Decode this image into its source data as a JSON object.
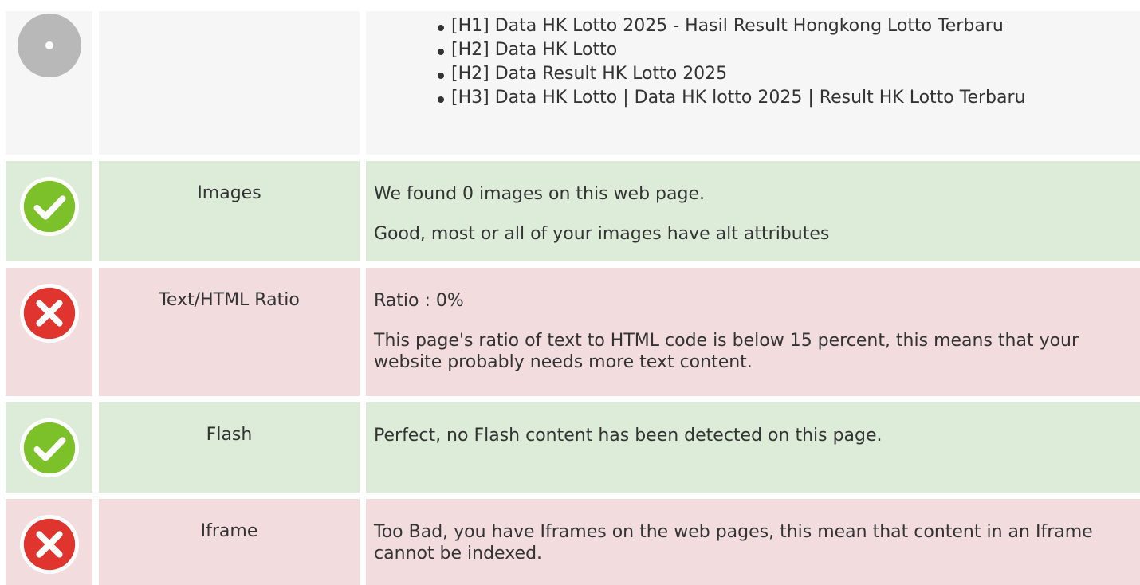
{
  "headings_row": {
    "icon": "neutral-circle-icon",
    "items": [
      "[H1] Data HK Lotto 2025 - Hasil Result Hongkong Lotto Terbaru",
      "[H2] Data HK Lotto",
      "[H2] Data Result HK Lotto 2025",
      "[H3] Data HK Lotto | Data HK lotto 2025 | Result HK Lotto Terbaru"
    ]
  },
  "rows": [
    {
      "status": "pass",
      "icon": "check-icon",
      "label": "Images",
      "paragraphs": [
        "We found 0 images on this web page.",
        "Good, most or all of your images have alt attributes"
      ]
    },
    {
      "status": "fail",
      "icon": "cross-icon",
      "label": "Text/HTML Ratio",
      "paragraphs": [
        "Ratio : 0%",
        "This page's ratio of text to HTML code is below 15 percent, this means that your website probably needs more text content."
      ]
    },
    {
      "status": "pass",
      "icon": "check-icon",
      "label": "Flash",
      "paragraphs": [
        "Perfect, no Flash content has been detected on this page."
      ]
    },
    {
      "status": "fail",
      "icon": "cross-icon",
      "label": "Iframe",
      "paragraphs": [
        "Too Bad, you have Iframes on the web pages, this mean that content in an Iframe cannot be indexed."
      ]
    }
  ],
  "colors": {
    "pass_bg": "#dcecd9",
    "fail_bg": "#f2dcdd",
    "neutral_bg": "#f6f6f6",
    "check": "#7cc02a",
    "cross": "#e0352e"
  }
}
